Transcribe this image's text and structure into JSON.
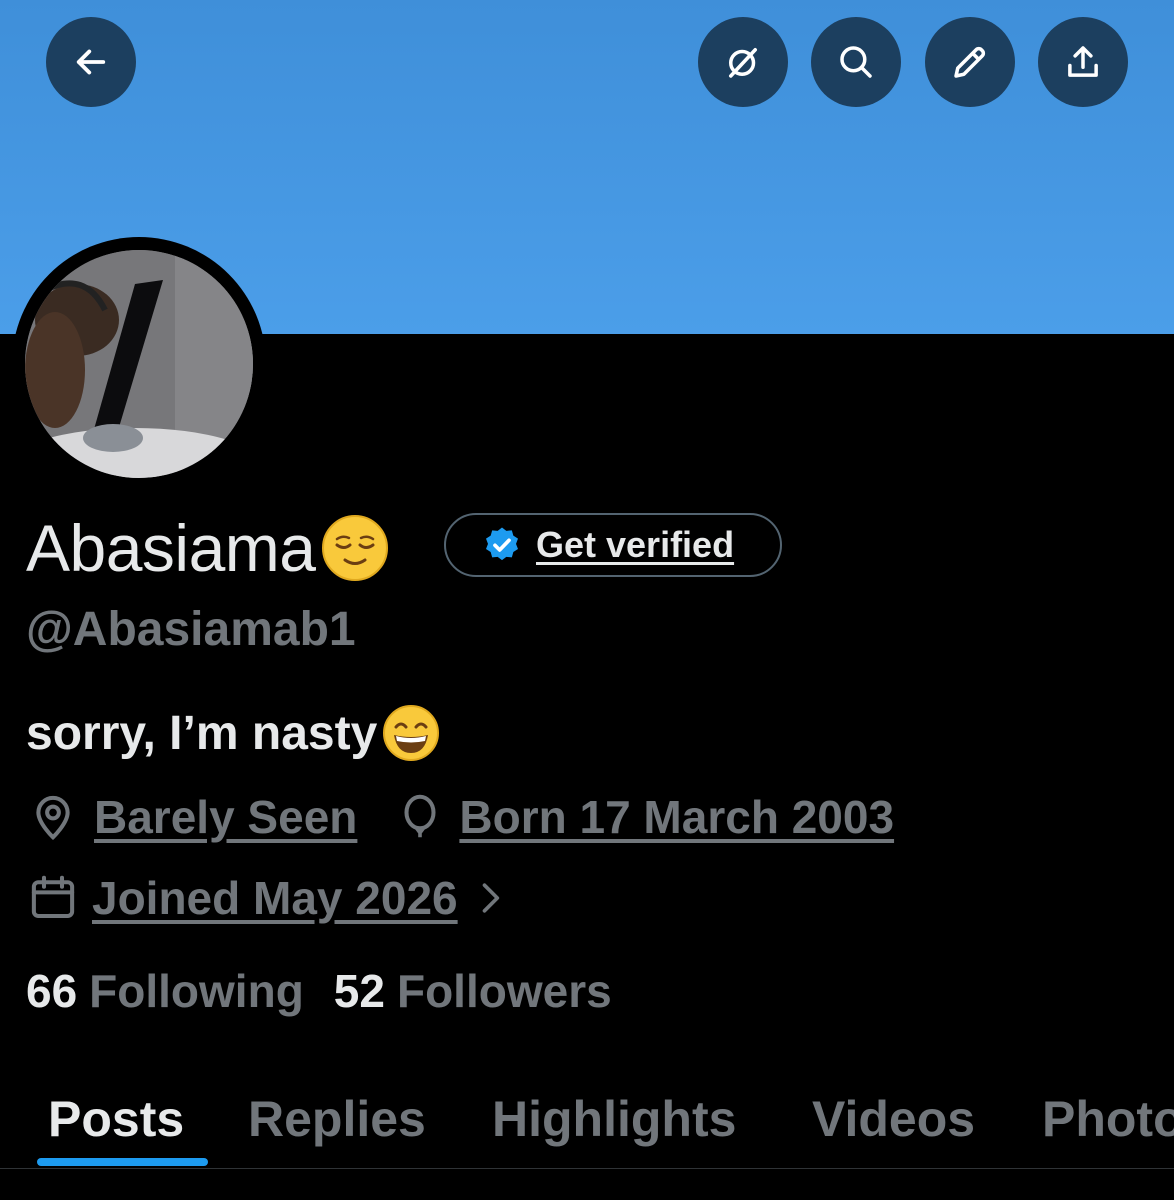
{
  "header": {
    "buttons": [
      {
        "icon": "back-arrow-icon"
      },
      {
        "icon": "grok-icon"
      },
      {
        "icon": "search-icon"
      },
      {
        "icon": "edit-pencil-icon"
      },
      {
        "icon": "share-icon"
      }
    ],
    "banner_color": "#4b9ee9"
  },
  "profile": {
    "display_name": "Abasiama",
    "name_emoji": "😌",
    "verify_button_label": "Get verified",
    "handle": "@Abasiamab1",
    "bio": "sorry, I’m nasty",
    "bio_emoji": "😄",
    "location": "Barely Seen",
    "birthday": "Born 17 March 2003",
    "joined": "Joined May 2026"
  },
  "stats": {
    "following_count": "66",
    "following_label": "Following",
    "followers_count": "52",
    "followers_label": "Followers"
  },
  "tabs": [
    "Posts",
    "Replies",
    "Highlights",
    "Videos",
    "Photos"
  ],
  "active_tab": "Posts",
  "colors": {
    "accent": "#1d9bf0",
    "muted_text": "#71767b",
    "primary_text": "#e7e9ea",
    "button_bg": "#1c3f5f"
  }
}
